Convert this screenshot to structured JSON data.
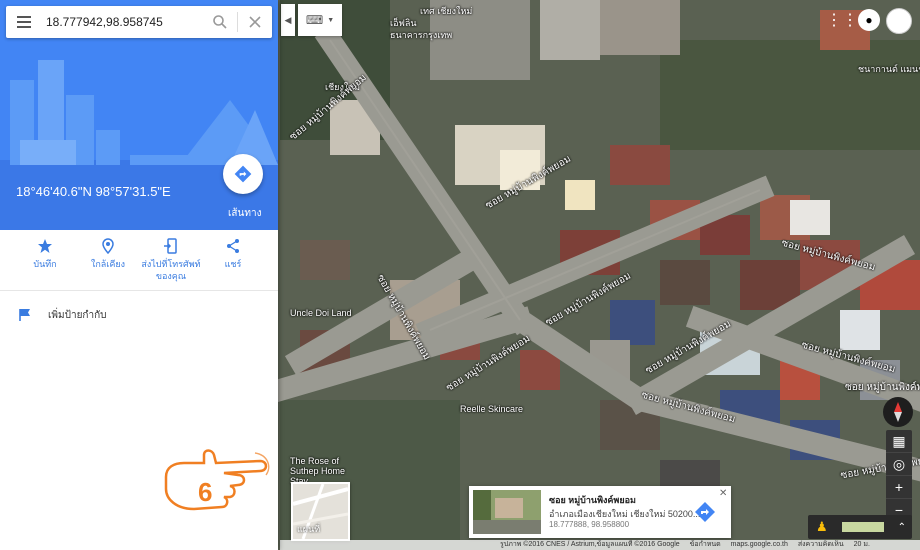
{
  "search": {
    "value": "18.777942,98.958745"
  },
  "place": {
    "coords_title": "18°46'40.6\"N 98°57'31.5\"E",
    "directions_label": "เส้นทาง"
  },
  "actions": [
    {
      "label": "บันทึก",
      "icon": "star-icon"
    },
    {
      "label": "ใกล้เคียง",
      "icon": "nearby-icon"
    },
    {
      "label": "ส่งไปที่โทรศัพท์ของคุณ",
      "icon": "send-to-phone-icon"
    },
    {
      "label": "แชร์",
      "icon": "share-icon"
    }
  ],
  "add_label": {
    "text": "เพิ่มป้ายกำกับ",
    "icon": "flag-icon"
  },
  "tutorial_step": "6",
  "map_labels": {
    "top_left_1": "เทศ เชียงใหม่",
    "top_left_2": "เอ็ฟลิน",
    "top_left_3": "ธนาคารกรุงเทพ",
    "top_left_4": "เชียงใหม่",
    "top_right": "ชนากานต์ แมนชั่น",
    "uncle_doi": "Uncle Doi Land",
    "reelle": "Reelle Skincare",
    "rose": "The Rose of Suthep Home Stay"
  },
  "road_labels": [
    "ซอย หมู่บ้านพิงค์พยอม",
    "ซอย หมู่บ้านพิงค์พยอม",
    "ซอย หมู่บ้านพิงค์พยอม",
    "ซอย หมู่บ้านพิงค์พยอม",
    "ซอย หมู่บ้านพิงค์พยอม",
    "ซอย หมู่บ้านพิงค์พยอม",
    "ซอย หมู่บ้านพิงค์พยอม",
    "ซอย หมู่บ้านพิงค์พยอม",
    "ซอย หมู่บ้านพิงค์พยอม",
    "ซอย หมู่บ้านพิงค์พยอม",
    "ซอย หมู่บ้านพิงค์พยอม"
  ],
  "satellite_thumb_label": "แผนที่",
  "place_card": {
    "title": "ซอย หมู่บ้านพิงค์พยอม",
    "address": "อำเภอเมืองเชียงใหม่ เชียงใหม่ 50200...",
    "coords": "18.777888, 98.958800"
  },
  "footer": {
    "imagery": "รูปภาพ ©2016 CNES / Astrium,ข้อมูลแผนที่ ©2016 Google",
    "terms": "ข้อกำหนด",
    "domain": "maps.google.co.th",
    "feedback": "ส่งความคิดเห็น",
    "scale": "20 ม."
  },
  "colors": {
    "accent": "#4285f4",
    "marker": "#e53935",
    "hand_badge": "#f07f22"
  }
}
